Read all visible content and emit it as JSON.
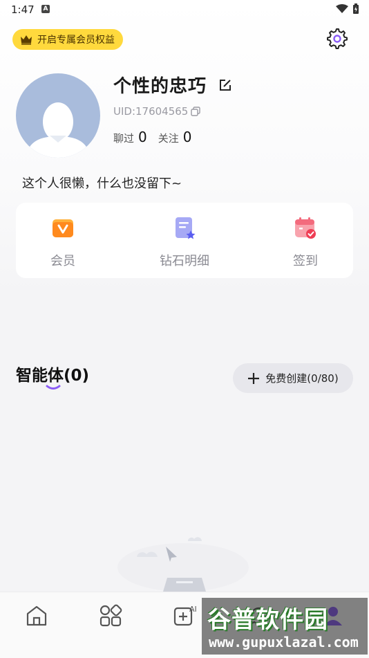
{
  "status_bar": {
    "time": "1:47",
    "indicator": "A"
  },
  "vip": {
    "label": "开启专属会员权益",
    "icon": "crown-icon"
  },
  "profile": {
    "username": "个性的忠巧",
    "uid": "UID:17604565",
    "stats": [
      {
        "label": "聊过",
        "value": "0"
      },
      {
        "label": "关注",
        "value": "0"
      }
    ],
    "bio": "这个人很懒，什么也没留下~"
  },
  "quick_actions": [
    {
      "label": "会员",
      "icon": "vip-card-icon"
    },
    {
      "label": "钻石明细",
      "icon": "diamond-detail-icon"
    },
    {
      "label": "签到",
      "icon": "calendar-checkin-icon"
    }
  ],
  "agents": {
    "title": "智能体(0)",
    "create_label": "免费创建(0/80)"
  },
  "bottom_nav": [
    {
      "icon": "home-icon"
    },
    {
      "icon": "apps-grid-icon"
    },
    {
      "icon": "ai-create-icon",
      "text": "AI"
    },
    {
      "icon": "chat-icon"
    },
    {
      "icon": "profile-icon"
    }
  ],
  "watermark": {
    "main": "谷普软件园",
    "url": "www.gupuxlazal.com"
  },
  "colors": {
    "accent": "#8b5cf6",
    "vip": "#ffd93d"
  }
}
